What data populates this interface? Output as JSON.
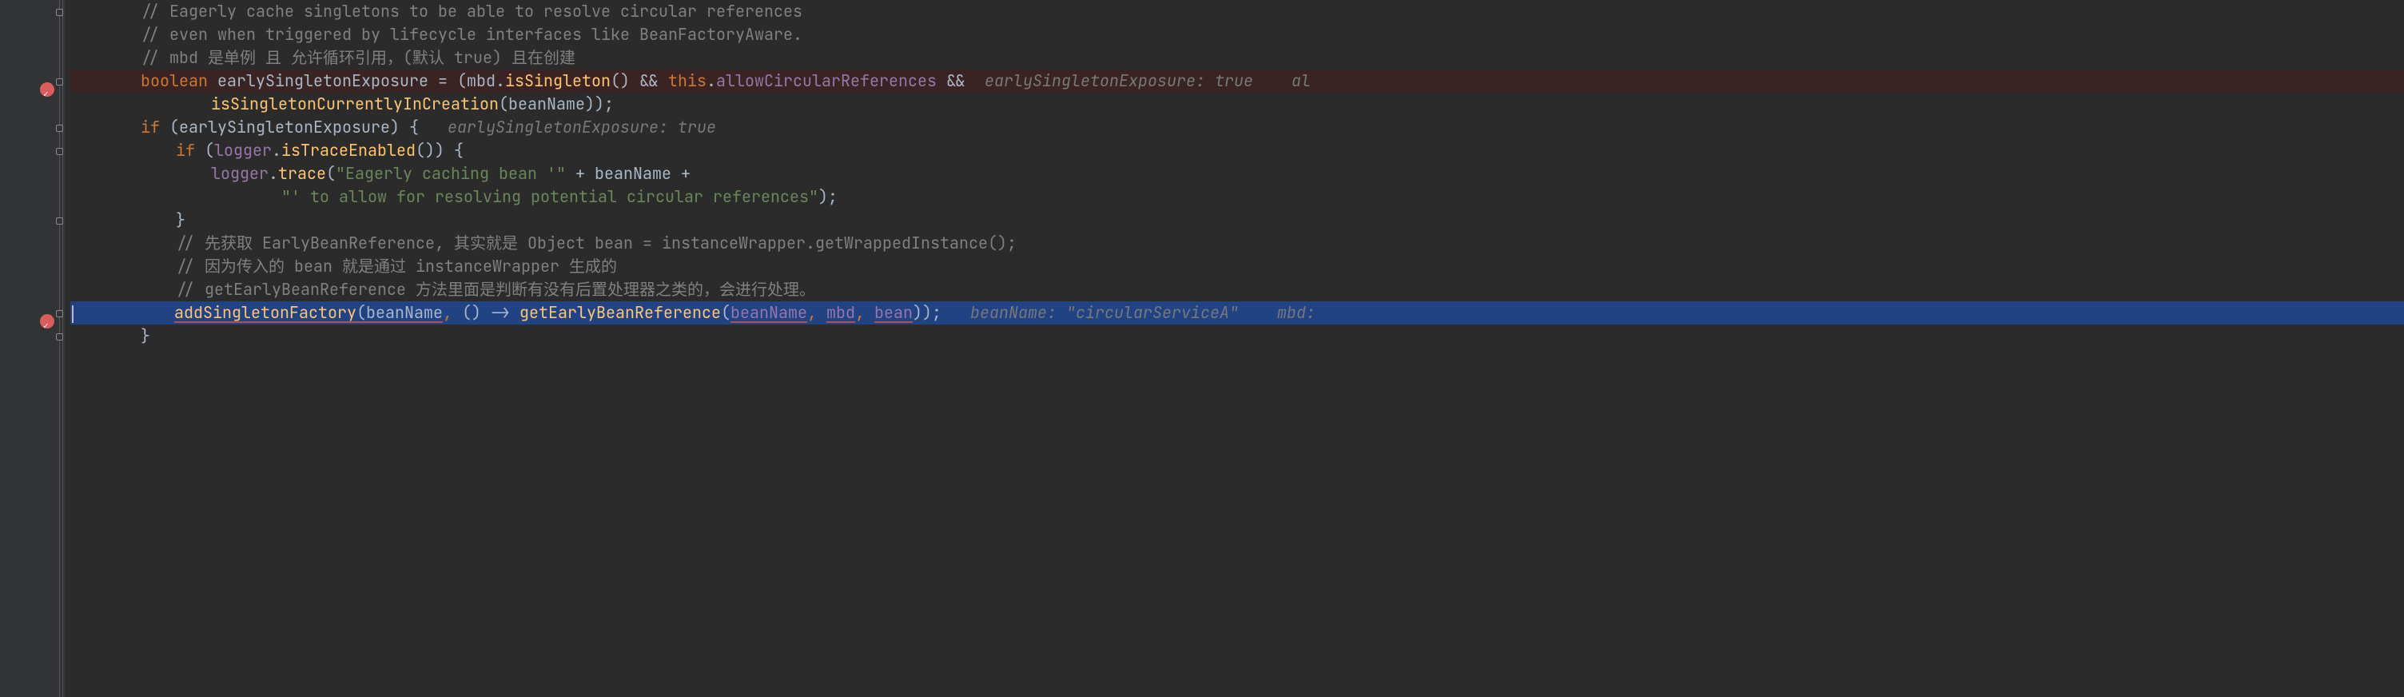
{
  "lines": {
    "c1": "// Eagerly cache singletons to be able to resolve circular references",
    "c2": "// even when triggered by lifecycle interfaces like BeanFactoryAware.",
    "c3": "// mbd 是单例 且 允许循环引用，(默认 true) 且在创建",
    "kw_boolean": "boolean",
    "var_ese": " earlySingletonExposure = (mbd.",
    "m_isSingleton": "isSingleton",
    "post_isSingleton": "() && ",
    "kw_this": "this",
    "dot": ".",
    "fld_allow": "allowCircularReferences",
    "amp": " &&",
    "hint1": "  earlySingletonExposure: true    al",
    "l5a": "isSingletonCurrentlyInCreation",
    "l5b": "(beanName));",
    "kw_if": "if",
    "l6a": " (earlySingletonExposure) {",
    "hint2": "   earlySingletonExposure: true",
    "l7a": " (",
    "fld_logger": "logger",
    "l7b": ".",
    "m_isTrace": "isTraceEnabled",
    "l7c": "()) {",
    "l8a": ".",
    "m_trace": "trace",
    "l8b": "(",
    "s1": "\"Eagerly caching bean '\"",
    "l8c": " + beanName +",
    "s2": "\"' to allow for resolving potential circular references\"",
    "l9b": ");",
    "l10": "}",
    "c4": "// 先获取 EarlyBeanReference, 其实就是 Object bean = instanceWrapper.getWrappedInstance();",
    "c5": "// 因为传入的 bean 就是通过 instanceWrapper 生成的",
    "c6": "// getEarlyBeanReference 方法里面是判断有没有后置处理器之类的，会进行处理。",
    "m_addSF": "addSingletonFactory",
    "l14a": "(beanName",
    "comma": ", ",
    "l14b": "() -> ",
    "m_getEBR": "getEarlyBeanReference",
    "l14c": "(",
    "p1": "beanName",
    "p2": "mbd",
    "p3": "bean",
    "l14d": "));",
    "hint3": "   beanName: \"circularServiceA\"    mbd:",
    "l15": "}"
  }
}
